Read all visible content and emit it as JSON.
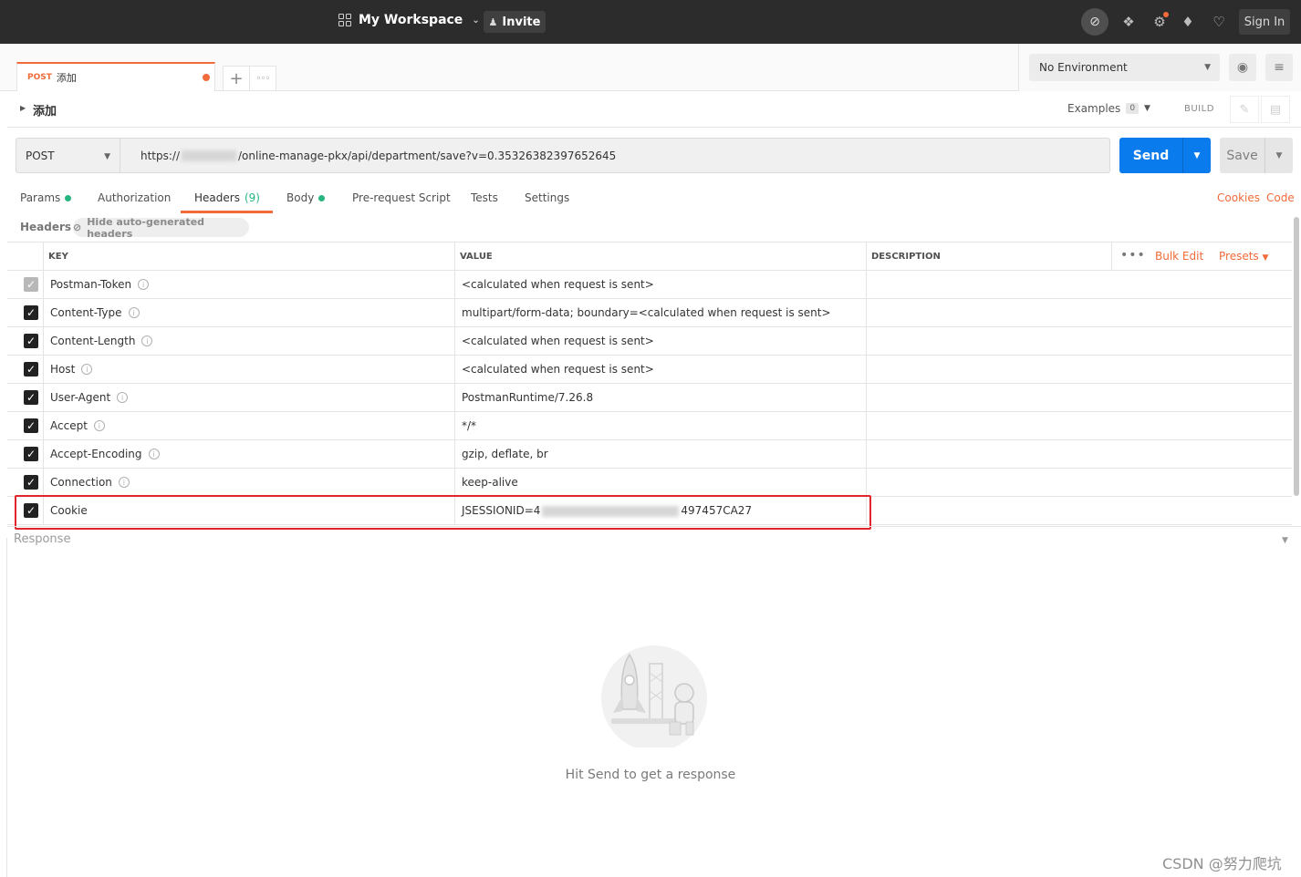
{
  "topbar": {
    "workspace": "My Workspace",
    "invite": "Invite",
    "sign_in": "Sign In",
    "icons": [
      "workspace-grid-icon",
      "sync-off-icon",
      "satellite-icon",
      "settings-icon",
      "bell-icon",
      "heart-icon"
    ]
  },
  "tabs": {
    "active": {
      "method": "POST",
      "name": "添加"
    }
  },
  "environment": {
    "selected": "No Environment"
  },
  "request": {
    "name": "添加",
    "examples_label": "Examples",
    "examples_count": "0",
    "build": "BUILD",
    "method": "POST",
    "url_prefix": "https://",
    "url_suffix": "/online-manage-pkx/api/department/save?v=0.35326382397652645",
    "send": "Send",
    "save": "Save"
  },
  "subtabs": {
    "params": "Params",
    "authorization": "Authorization",
    "headers": "Headers",
    "headers_count": "(9)",
    "body": "Body",
    "prerequest": "Pre-request Script",
    "tests": "Tests",
    "settings": "Settings",
    "cookies": "Cookies",
    "code": "Code"
  },
  "headers_bar": {
    "label": "Headers",
    "hide_btn": "Hide auto-generated headers"
  },
  "table": {
    "col_key": "KEY",
    "col_value": "VALUE",
    "col_description": "DESCRIPTION",
    "bulk_edit": "Bulk Edit",
    "presets": "Presets",
    "rows": [
      {
        "key": "Postman-Token",
        "value": "<calculated when request is sent>"
      },
      {
        "key": "Content-Type",
        "value": "multipart/form-data; boundary=<calculated when request is sent>"
      },
      {
        "key": "Content-Length",
        "value": "<calculated when request is sent>"
      },
      {
        "key": "Host",
        "value": "<calculated when request is sent>"
      },
      {
        "key": "User-Agent",
        "value": "PostmanRuntime/7.26.8"
      },
      {
        "key": "Accept",
        "value": "*/*"
      },
      {
        "key": "Accept-Encoding",
        "value": "gzip, deflate, br"
      },
      {
        "key": "Connection",
        "value": "keep-alive"
      },
      {
        "key": "Cookie",
        "value_prefix": "JSESSIONID=4",
        "value_suffix": "497457CA27"
      }
    ]
  },
  "response": {
    "title": "Response",
    "empty_text": "Hit Send to get a response"
  },
  "watermark": "CSDN @努力爬坑",
  "colors": {
    "accent": "#f26b3a",
    "send_blue": "#097bed",
    "highlight_red": "#e2252b",
    "green": "#26b47f"
  }
}
